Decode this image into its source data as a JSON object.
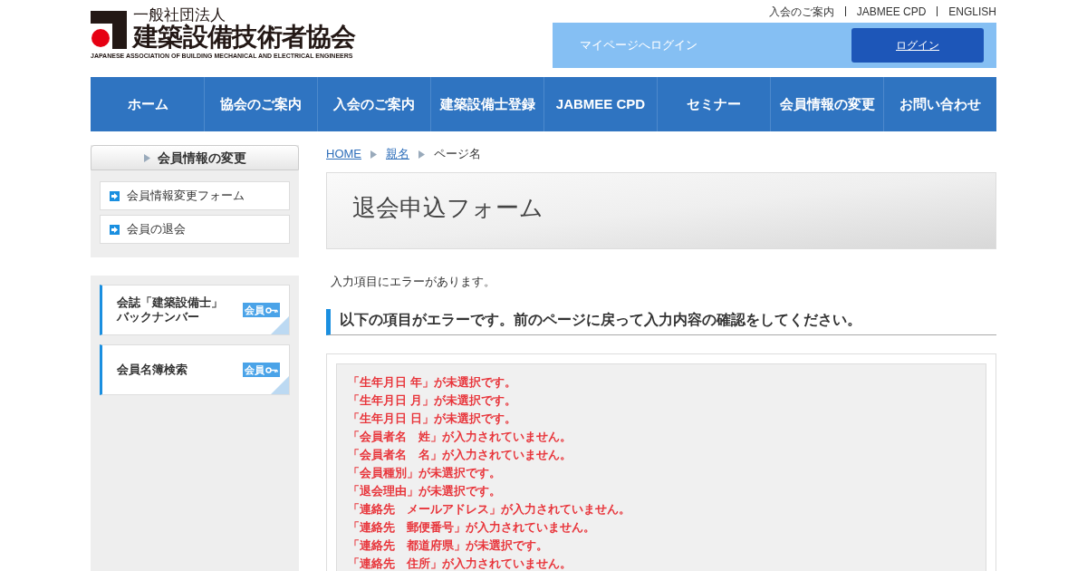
{
  "header": {
    "logo": {
      "subtitle": "一般社団法人",
      "name": "建築設備技術者協会",
      "english": "JAPANESE ASSOCIATION OF BUILDING MECHANICAL AND ELECTRICAL ENGINEERS"
    },
    "top_links": [
      "入会のご案内",
      "JABMEE CPD",
      "ENGLISH"
    ],
    "login_bar": {
      "label": "マイページへログイン",
      "button": "ログイン"
    }
  },
  "nav": [
    {
      "label": "ホーム",
      "selected": false
    },
    {
      "label": "協会のご案内",
      "selected": false
    },
    {
      "label": "入会のご案内",
      "selected": false
    },
    {
      "label": "建築設備士登録",
      "selected": false
    },
    {
      "label": "JABMEE CPD",
      "selected": false
    },
    {
      "label": "セミナー",
      "selected": false
    },
    {
      "label": "会員情報の変更",
      "selected": false
    },
    {
      "label": "お問い合わせ",
      "selected": false
    }
  ],
  "sidebar": {
    "title": "会員情報の変更",
    "items": [
      "会員情報変更フォーム",
      "会員の退会"
    ],
    "banners": [
      {
        "label": "会誌「建築設備士」バックナンバー",
        "badge": "会員"
      },
      {
        "label": "会員名簿検索",
        "badge": "会員"
      }
    ]
  },
  "breadcrumb": [
    {
      "label": "HOME",
      "link": true
    },
    {
      "label": "親名",
      "link": true
    },
    {
      "label": "ページ名",
      "link": false
    }
  ],
  "page_title": "退会申込フォーム",
  "notice": "入力項目にエラーがあります。",
  "section_heading": "以下の項目がエラーです。前のページに戻って入力内容の確認をしてください。",
  "errors": [
    "「生年月日 年」が未選択です。",
    "「生年月日 月」が未選択です。",
    "「生年月日 日」が未選択です。",
    "「会員者名　姓」が入力されていません。",
    "「会員者名　名」が入力されていません。",
    "「会員種別」が未選択です。",
    "「退会理由」が未選択です。",
    "「連絡先　メールアドレス」が入力されていません。",
    "「連絡先　郵便番号」が入力されていません。",
    "「連絡先　都道府県」が未選択です。",
    "「連絡先　住所」が入力されていません。"
  ]
}
